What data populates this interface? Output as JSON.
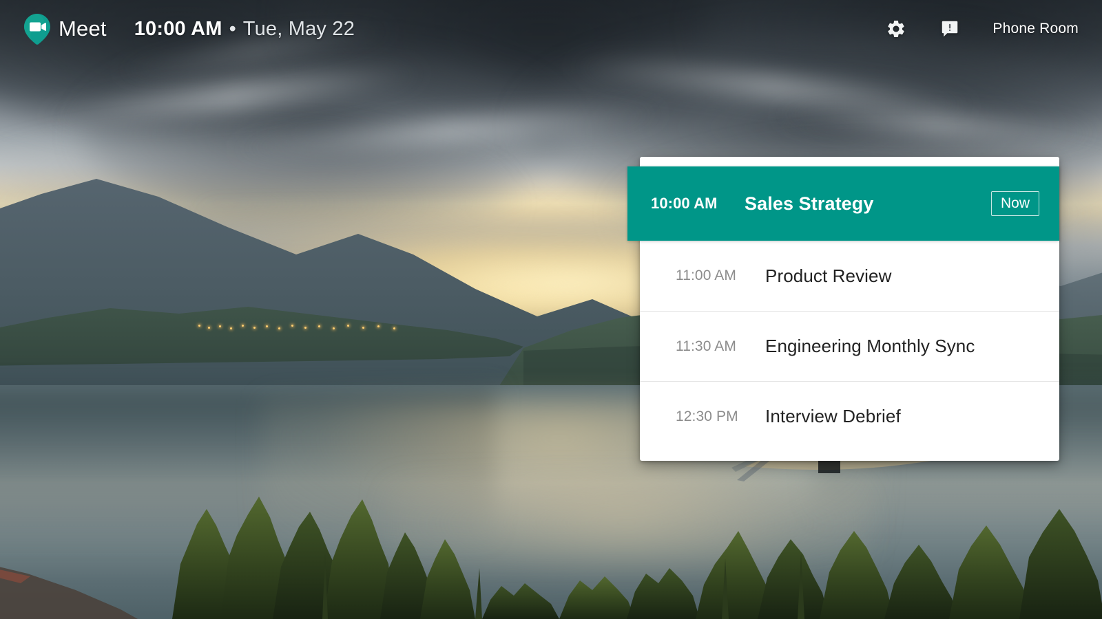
{
  "topbar": {
    "logo_icon": "meet-video-pin-icon",
    "brand": "Meet",
    "time": "10:00 AM",
    "separator": "•",
    "date": "Tue, May 22",
    "settings_icon": "gear-icon",
    "feedback_icon": "feedback-speech-bubble-icon",
    "room_name": "Phone Room"
  },
  "agenda": {
    "current": {
      "time": "10:00 AM",
      "title": "Sales Strategy",
      "badge": "Now"
    },
    "upcoming": [
      {
        "time": "11:00 AM",
        "title": "Product Review"
      },
      {
        "time": "11:30 AM",
        "title": "Engineering Monthly Sync"
      },
      {
        "time": "12:30 PM",
        "title": "Interview Debrief"
      }
    ]
  },
  "colors": {
    "accent_teal": "#009688",
    "card_bg": "#ffffff",
    "row_time": "#8c8c8c",
    "row_title": "#222222",
    "divider": "#e4e4e4",
    "topbar_text": "#ffffff"
  }
}
